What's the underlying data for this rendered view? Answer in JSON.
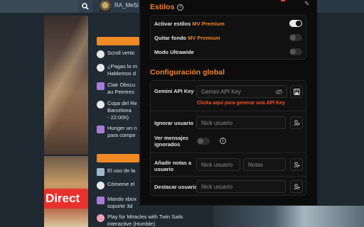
{
  "header": {
    "username": "RA_MeSi"
  },
  "background": {
    "banner_text": "Direct",
    "feed": [
      {
        "text": "Scroll vertic",
        "icon": "chat-bubble",
        "color": "#e8e8e8"
      },
      {
        "text": "¿Pagas lo m\nHablemos d",
        "icon": "chat-bubble",
        "color": "#e8e8e8"
      },
      {
        "text": "Clair Obscu\nau Peintres",
        "icon": "space-invader",
        "color": "#a97ad8"
      },
      {
        "text": "Copa del Re\nBarcelona \n- 22:00h)",
        "icon": "soccer-ball",
        "color": "#e8e8e8"
      },
      {
        "text": "Hunger un n\npara compe",
        "icon": "space-invader",
        "color": "#a97ad8"
      },
      {
        "text": "El uso de la",
        "icon": "picture",
        "color": "#9fb8c9"
      },
      {
        "text": "Cómeme el",
        "icon": "chat-bubble",
        "color": "#e8e8e8"
      },
      {
        "text": "Mando xbox\nsoporte 3d",
        "icon": "space-invader",
        "color": "#a97ad8"
      },
      {
        "text": "Play for Miracles with Twin Sails\ninteractive (Humble)",
        "icon": "piggy-bank",
        "color": "#f2a0b6"
      }
    ]
  },
  "styles": {
    "title": "Estilos",
    "options": [
      {
        "prefix": "Activar estilos ",
        "highlight": "MV Premium",
        "enabled": true
      },
      {
        "prefix": "Quitar fondo ",
        "highlight": "MV Premium",
        "enabled": false
      },
      {
        "prefix": "Modo Ultrawide",
        "highlight": "",
        "enabled": false
      }
    ]
  },
  "global": {
    "title": "Configuración global",
    "gemini_label": "Gemini API Key",
    "gemini_placeholder": "Gemini API Key",
    "gemini_link": "Clicka aquí para generar una API Key",
    "ignore_label": "Ignorar usuario",
    "ignore_placeholder": "Nick usuario",
    "show_ignored_label": "Ver mensajes\nignorados",
    "show_ignored_enabled": false,
    "notes_label": "Añadir notas a\nusuario",
    "notes_user_placeholder": "Nick usuario",
    "notes_placeholder": "Notas",
    "highlight_label": "Destacar usuario",
    "highlight_placeholder": "Nick usuario"
  },
  "colors": {
    "accent": "#f0832b",
    "link": "#f0532b",
    "panel_bg": "#0c0c0c"
  }
}
